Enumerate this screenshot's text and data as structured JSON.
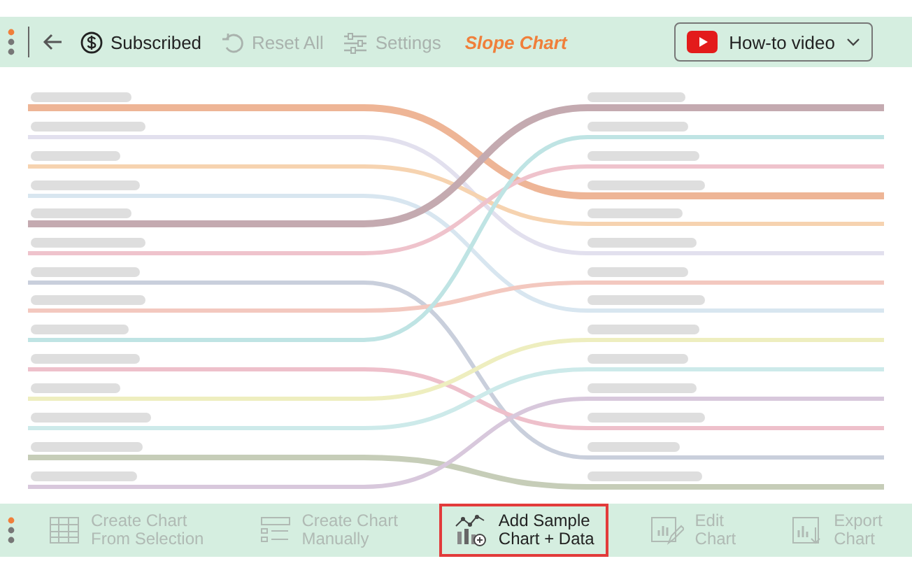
{
  "top_bar": {
    "items": [
      {
        "kind": "subscribed",
        "label": "Subscribed",
        "disabled": false
      },
      {
        "kind": "reset",
        "label": "Reset All",
        "disabled": true
      },
      {
        "kind": "settings",
        "label": "Settings",
        "disabled": true
      }
    ],
    "title": "Slope Chart",
    "video_button": {
      "label": "How-to video"
    }
  },
  "bottom_bar": {
    "buttons": [
      {
        "kind": "table",
        "lines": [
          "Create Chart",
          "From Selection"
        ],
        "disabled": true,
        "selected": false
      },
      {
        "kind": "form",
        "lines": [
          "Create Chart",
          "Manually"
        ],
        "disabled": true,
        "selected": false
      },
      {
        "kind": "sample",
        "lines": [
          "Add Sample",
          "Chart + Data"
        ],
        "disabled": false,
        "selected": true
      },
      {
        "kind": "edit",
        "lines": [
          "Edit",
          "Chart"
        ],
        "disabled": true,
        "selected": false
      },
      {
        "kind": "export",
        "lines": [
          "Export",
          "Chart"
        ],
        "disabled": true,
        "selected": false
      }
    ]
  }
}
